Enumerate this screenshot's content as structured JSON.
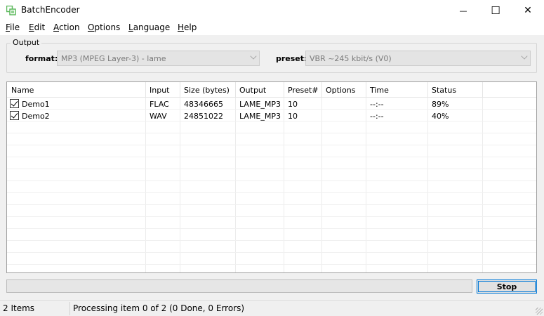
{
  "window": {
    "title": "BatchEncoder",
    "minimize_glyph": "—",
    "maximize_glyph": "☐",
    "close_glyph": "✕",
    "app_icon": "batchencoder-app-icon"
  },
  "menu": [
    {
      "first": "F",
      "rest": "ile"
    },
    {
      "first": "E",
      "rest": "dit"
    },
    {
      "first": "A",
      "rest": "ction"
    },
    {
      "first": "O",
      "rest": "ptions"
    },
    {
      "first": "L",
      "rest": "anguage"
    },
    {
      "first": "H",
      "rest": "elp"
    }
  ],
  "output": {
    "group_label": "Output",
    "format_label": "format:",
    "format_value": "MP3 (MPEG Layer-3) - lame",
    "preset_label": "preset:",
    "preset_value": "VBR ~245 kbit/s (V0)"
  },
  "list": {
    "columns": [
      "Name",
      "Input",
      "Size (bytes)",
      "Output",
      "Preset#",
      "Options",
      "Time",
      "Status"
    ],
    "rows": [
      {
        "checked": true,
        "name": "Demo1",
        "input": "FLAC",
        "size": "48346665",
        "output": "LAME_MP3",
        "preset": "10",
        "options": "",
        "time": "--:--",
        "status": "89%"
      },
      {
        "checked": true,
        "name": "Demo2",
        "input": "WAV",
        "size": "24851022",
        "output": "LAME_MP3",
        "preset": "10",
        "options": "",
        "time": "--:--",
        "status": "40%"
      }
    ]
  },
  "progress": {
    "fraction": 0
  },
  "stop_label": "Stop",
  "status": {
    "items": "2 Items",
    "message": "Processing item 0 of 2 (0 Done, 0 Errors)"
  }
}
